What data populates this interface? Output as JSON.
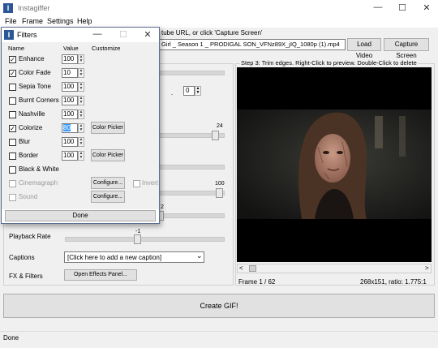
{
  "app": {
    "title": "Instagiffer",
    "menu": [
      "File",
      "Frame",
      "Settings",
      "Help"
    ],
    "minimize": "—",
    "maximize": "☐",
    "close": "✕"
  },
  "source": {
    "hint": "tube URL, or click 'Capture Screen'",
    "path": "Girl _ Season 1 _ PRODIGAL SON_VFNz89X_jIQ_1080p (1).mp4",
    "load_label": "Load Video",
    "capture_label": "Capture Screen"
  },
  "step3": {
    "label": "Step 3: Trim edges. Right-Click to preview. Double-Click to delete"
  },
  "preview": {
    "frame_label": "Frame  1 / 62",
    "size_label": "268x151, ratio: 1.775:1",
    "scroll_left": "<",
    "scroll_right": ">"
  },
  "settings": {
    "time_value": "0",
    "time_sep": ".",
    "slider1_value": "24",
    "slider1_level": 0.9,
    "slider2_value": "100",
    "slider2_level": 0.97,
    "slider3_value": "2",
    "slider3_level": 0.6,
    "playback_label": "Playback Rate",
    "playback_value": "-1",
    "playback_level": 0.45,
    "captions_label": "Captions",
    "captions_value": "[Click here to add a new caption]",
    "fx_label": "FX & Filters",
    "effects_button": "Open Effects Panel..."
  },
  "create_gif": "Create GIF!",
  "status": "Done",
  "filters": {
    "title": "Filters",
    "minimize": "—",
    "maximize": "☐",
    "close": "✕",
    "headers": {
      "name": "Name",
      "value": "Value",
      "customize": "Customize"
    },
    "rows": [
      {
        "name": "Enhance",
        "checked": true,
        "value": "100"
      },
      {
        "name": "Color Fade",
        "checked": true,
        "value": "10"
      },
      {
        "name": "Sepia Tone",
        "checked": false,
        "value": "100"
      },
      {
        "name": "Burnt Corners",
        "checked": false,
        "value": "100"
      },
      {
        "name": "Nashville",
        "checked": false,
        "value": "100"
      },
      {
        "name": "Colorize",
        "checked": true,
        "value": "80",
        "button": "Color Picker"
      },
      {
        "name": "Blur",
        "checked": false,
        "value": "100"
      },
      {
        "name": "Border",
        "checked": false,
        "value": "100",
        "button": "Color Picker"
      },
      {
        "name": "Black & White",
        "checked": false
      },
      {
        "name": "Cinemagraph",
        "checked": false,
        "disabled": true,
        "button": "Configure...",
        "extra_checkbox": "Invert"
      },
      {
        "name": "Sound",
        "checked": false,
        "disabled": true,
        "button": "Configure..."
      }
    ],
    "done_label": "Done"
  },
  "icons": {
    "app": "instagiffer-logo-icon",
    "check": "✓",
    "spin_up": "▲",
    "spin_down": "▼",
    "dropdown": "⌄"
  }
}
